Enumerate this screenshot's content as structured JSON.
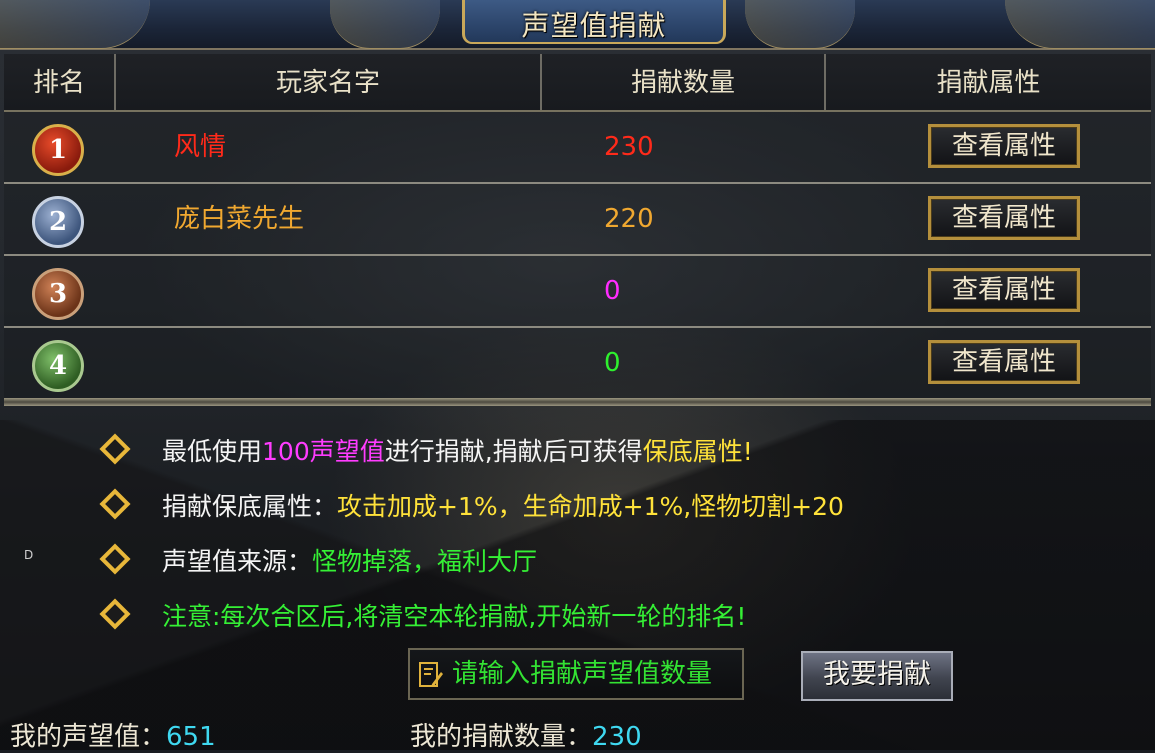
{
  "window": {
    "title": "声望值捐献"
  },
  "table": {
    "headers": [
      "排名",
      "玩家名字",
      "捐献数量",
      "捐献属性"
    ],
    "rows": [
      {
        "rank": "1",
        "name": "风情",
        "count": "230",
        "button": "查看属性",
        "color": "#ff2a1a"
      },
      {
        "rank": "2",
        "name": "庞白菜先生",
        "count": "220",
        "button": "查看属性",
        "color": "#f0a830"
      },
      {
        "rank": "3",
        "name": "",
        "count": "0",
        "button": "查看属性",
        "color": "#ff2cff"
      },
      {
        "rank": "4",
        "name": "",
        "count": "0",
        "button": "查看属性",
        "color": "#2ef02e"
      }
    ]
  },
  "notes": {
    "n1_a": "最低使用",
    "n1_b": "100声望值",
    "n1_c": "进行捐献,捐献后可获得",
    "n1_d": "保底属性!",
    "n2_a": "捐献保底属性：",
    "n2_b": "攻击加成+1%，生命加成+1%,怪物切割+20",
    "n3_a": "声望值来源：",
    "n3_b": "怪物掉落，福利大厅",
    "n4": "注意:每次合区后,将清空本轮捐献,开始新一轮的排名!"
  },
  "side_mark": "D",
  "donate": {
    "input_placeholder": "请输入捐献声望值数量",
    "button": "我要捐献"
  },
  "footer": {
    "my_reputation_label": "我的声望值：",
    "my_reputation_value": "651",
    "my_donation_label": "我的捐献数量：",
    "my_donation_value": "230"
  },
  "icons": [
    "rank-1-medal-icon",
    "rank-2-medal-icon",
    "rank-3-medal-icon",
    "rank-4-medal-icon",
    "diamond-bullet-icon",
    "edit-icon"
  ]
}
